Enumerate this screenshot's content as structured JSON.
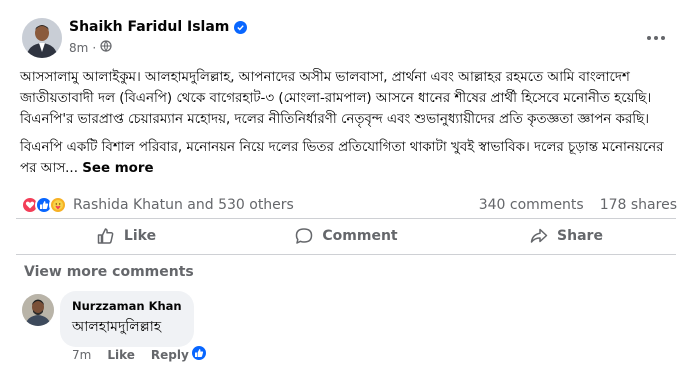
{
  "post": {
    "author": "Shaikh Faridul Islam",
    "time": "8m",
    "paragraphs": [
      "আসসালামু আলাইকুম।  আলহামদুলিল্লাহ,  আপনাদের অসীম ভালবাসা, প্রার্থনা এবং  আল্লাহর রহমতে আমি বাংলাদেশ জাতীয়তাবাদী দল (বিএনপি) থেকে বাগেরহাট-৩ (মোংলা-রামপাল) আসনে ধানের শীষের প্রার্থী হিসেবে মনোনীত হয়েছি। বিএনপি'র ভারপ্রাপ্ত চেয়ারম্যান মহোদয়, দলের নীতিনির্ধারণী নেতৃবৃন্দ এবং শুভানুধ্যায়ীদের প্রতি কৃতজ্ঞতা জ্ঞাপন করছি।",
      "বিএনপি একটি বিশাল পরিবার, মনোনয়ন নিয়ে দলের ভিতর প্রতিযোগিতা থাকাটা খুবই স্বাভাবিক।  দলের চূড়ান্ত মনোনয়নের পর আস..."
    ],
    "see_more": "See more"
  },
  "reactions": {
    "icons": [
      "love-icon",
      "like-icon",
      "care-icon"
    ],
    "summary": "Rashida Khatun and 530 others",
    "comments": "340 comments",
    "shares": "178 shares"
  },
  "actions": {
    "like": "Like",
    "comment": "Comment",
    "share": "Share"
  },
  "view_more_comments": "View more comments",
  "comment": {
    "author": "Nurzzaman Khan",
    "text": "আলহামদুলিল্লাহ",
    "time": "7m",
    "like": "Like",
    "reply": "Reply"
  },
  "colors": {
    "accent": "#0866ff",
    "love": "#f33e58",
    "care": "#f7b125",
    "muted_text": "#65676b"
  }
}
